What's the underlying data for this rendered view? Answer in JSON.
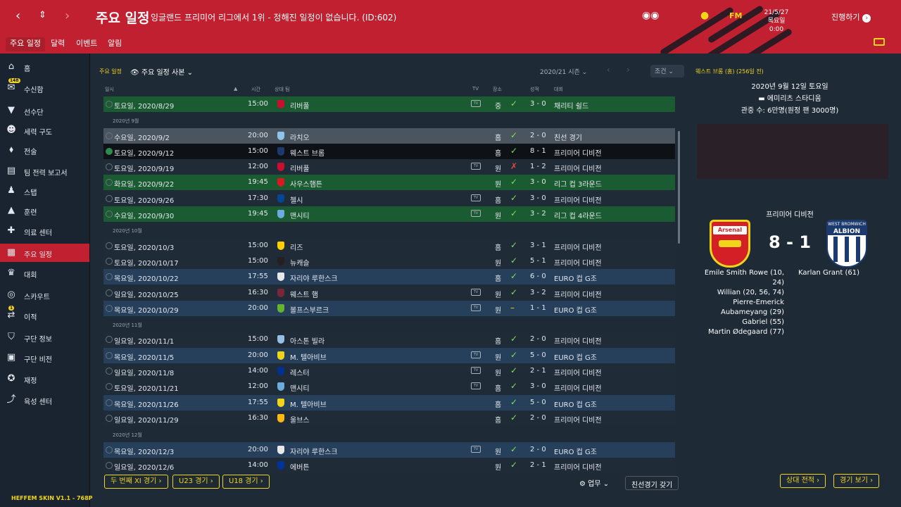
{
  "header": {
    "title": "주요 일정",
    "subtitle": "잉글랜드 프리미어 리그에서 1위 - 정해진 일정이 없습니다. (ID:602)",
    "fm": "FM",
    "date_line1": "21/5/27",
    "date_line2": "목요일 0:00",
    "continue_label": "진행하기"
  },
  "subtabs": [
    "주요 일정",
    "달력",
    "이벤트",
    "알림"
  ],
  "sidebar": {
    "items": [
      {
        "icon": "home-icon",
        "label": "홈"
      },
      {
        "icon": "inbox-icon",
        "label": "수신함",
        "badge": "148"
      },
      {
        "icon": "shirt-icon",
        "label": "선수단"
      },
      {
        "icon": "tactics-icon",
        "label": "세력 구도"
      },
      {
        "icon": "tactics-board-icon",
        "label": "전술"
      },
      {
        "icon": "report-icon",
        "label": "팀 전력 보고서"
      },
      {
        "icon": "staff-icon",
        "label": "스탭"
      },
      {
        "icon": "training-cone-icon",
        "label": "훈련"
      },
      {
        "icon": "medical-icon",
        "label": "의료 센터"
      },
      {
        "icon": "calendar-icon",
        "label": "주요 일정"
      },
      {
        "icon": "trophy-icon",
        "label": "대회"
      },
      {
        "icon": "binoculars-icon",
        "label": "스카우트"
      },
      {
        "icon": "transfer-icon",
        "label": "이적",
        "badge": "1"
      },
      {
        "icon": "shield-icon",
        "label": "구단 정보"
      },
      {
        "icon": "briefcase-icon",
        "label": "구단 비전"
      },
      {
        "icon": "finance-icon",
        "label": "재정"
      },
      {
        "icon": "development-icon",
        "label": "육성 센터"
      }
    ],
    "skin": "HEFFEM SKIN V1.1 - 768P"
  },
  "main": {
    "crumb": "주요 일정",
    "view": "주요 일정 사본",
    "season": "2020/21 시즌",
    "filter": "조건",
    "cols": {
      "date": "일시",
      "time": "시간",
      "opp": "상대 팀",
      "tv": "TV",
      "venue": "장소",
      "result": "성적",
      "comp": "대회"
    }
  },
  "rows": [
    {
      "t": "row",
      "s": "g",
      "date": "토요일, 2020/8/29",
      "time": "15:00",
      "opp": "리버풀",
      "crest": "#c8102e",
      "tv": true,
      "venue": "중",
      "res": "w",
      "score": "3 - 0",
      "comp": "채리티 쉴드"
    },
    {
      "t": "head",
      "label": "2020년 9월"
    },
    {
      "t": "row",
      "s": "sel",
      "date": "수요일, 2020/9/2",
      "time": "20:00",
      "opp": "라치오",
      "crest": "#8fc3e8",
      "tv": false,
      "venue": "홈",
      "res": "w",
      "score": "2 - 0",
      "comp": "친선 경기"
    },
    {
      "t": "row",
      "s": "blk",
      "date": "토요일, 2020/9/12",
      "time": "15:00",
      "opp": "웨스트 브롬",
      "crest": "#1c3a6e",
      "tv": false,
      "venue": "홈",
      "res": "w",
      "score": "8 - 1",
      "comp": "프리미어 디비전",
      "filled": true
    },
    {
      "t": "row",
      "s": "d",
      "date": "토요일, 2020/9/19",
      "time": "12:00",
      "opp": "리버풀",
      "crest": "#c8102e",
      "tv": true,
      "venue": "원",
      "res": "l",
      "score": "1 - 2",
      "comp": "프리미어 디비전"
    },
    {
      "t": "row",
      "s": "g",
      "date": "화요일, 2020/9/22",
      "time": "19:45",
      "opp": "사우스햄튼",
      "crest": "#d71920",
      "tv": false,
      "venue": "원",
      "res": "w",
      "score": "3 - 0",
      "comp": "리그 컵 3라운드"
    },
    {
      "t": "row",
      "s": "d",
      "date": "토요일, 2020/9/26",
      "time": "17:30",
      "opp": "첼시",
      "crest": "#034694",
      "tv": true,
      "venue": "홈",
      "res": "w",
      "score": "3 - 0",
      "comp": "프리미어 디비전"
    },
    {
      "t": "row",
      "s": "g",
      "date": "수요일, 2020/9/30",
      "time": "19:45",
      "opp": "맨시티",
      "crest": "#6cabdd",
      "tv": true,
      "venue": "원",
      "res": "w",
      "score": "3 - 2",
      "comp": "리그 컵 4라운드"
    },
    {
      "t": "head",
      "label": "2020년 10월"
    },
    {
      "t": "row",
      "s": "d",
      "date": "토요일, 2020/10/3",
      "time": "15:00",
      "opp": "리즈",
      "crest": "#ffcd00",
      "tv": false,
      "venue": "홈",
      "res": "w",
      "score": "3 - 1",
      "comp": "프리미어 디비전"
    },
    {
      "t": "row",
      "s": "d",
      "date": "토요일, 2020/10/17",
      "time": "15:00",
      "opp": "뉴캐슬",
      "crest": "#241f20",
      "tv": false,
      "venue": "원",
      "res": "w",
      "score": "5 - 1",
      "comp": "프리미어 디비전"
    },
    {
      "t": "row",
      "s": "b",
      "date": "목요일, 2020/10/22",
      "time": "17:55",
      "opp": "자리야 루한스크",
      "crest": "#e8e8e8",
      "tv": false,
      "venue": "홈",
      "res": "w",
      "score": "6 - 0",
      "comp": "EURO 컵 G조"
    },
    {
      "t": "row",
      "s": "d",
      "date": "일요일, 2020/10/25",
      "time": "16:30",
      "opp": "웨스트 햄",
      "crest": "#7a263a",
      "tv": true,
      "venue": "원",
      "res": "w",
      "score": "3 - 2",
      "comp": "프리미어 디비전"
    },
    {
      "t": "row",
      "s": "b",
      "date": "목요일, 2020/10/29",
      "time": "20:00",
      "opp": "볼프스부르크",
      "crest": "#65b32e",
      "tv": true,
      "venue": "원",
      "res": "d",
      "score": "1 - 1",
      "comp": "EURO 컵 G조"
    },
    {
      "t": "head",
      "label": "2020년 11월"
    },
    {
      "t": "row",
      "s": "d",
      "date": "일요일, 2020/11/1",
      "time": "15:00",
      "opp": "아스톤 빌라",
      "crest": "#95bfe5",
      "tv": false,
      "venue": "홈",
      "res": "w",
      "score": "2 - 0",
      "comp": "프리미어 디비전"
    },
    {
      "t": "row",
      "s": "b",
      "date": "목요일, 2020/11/5",
      "time": "20:00",
      "opp": "M. 텔아비브",
      "crest": "#f1d51a",
      "tv": true,
      "venue": "원",
      "res": "w",
      "score": "5 - 0",
      "comp": "EURO 컵 G조"
    },
    {
      "t": "row",
      "s": "d",
      "date": "일요일, 2020/11/8",
      "time": "14:00",
      "opp": "레스터",
      "crest": "#003090",
      "tv": true,
      "venue": "원",
      "res": "w",
      "score": "2 - 1",
      "comp": "프리미어 디비전"
    },
    {
      "t": "row",
      "s": "d",
      "date": "토요일, 2020/11/21",
      "time": "12:00",
      "opp": "맨시티",
      "crest": "#6cabdd",
      "tv": true,
      "venue": "홈",
      "res": "w",
      "score": "3 - 0",
      "comp": "프리미어 디비전"
    },
    {
      "t": "row",
      "s": "b",
      "date": "목요일, 2020/11/26",
      "time": "17:55",
      "opp": "M. 텔아비브",
      "crest": "#f1d51a",
      "tv": false,
      "venue": "홈",
      "res": "w",
      "score": "5 - 0",
      "comp": "EURO 컵 G조"
    },
    {
      "t": "row",
      "s": "d",
      "date": "일요일, 2020/11/29",
      "time": "16:30",
      "opp": "울브스",
      "crest": "#fdb913",
      "tv": false,
      "venue": "홈",
      "res": "w",
      "score": "2 - 0",
      "comp": "프리미어 디비전"
    },
    {
      "t": "head",
      "label": "2020년 12월"
    },
    {
      "t": "row",
      "s": "b",
      "date": "목요일, 2020/12/3",
      "time": "20:00",
      "opp": "자리야 루한스크",
      "crest": "#e8e8e8",
      "tv": true,
      "venue": "원",
      "res": "w",
      "score": "2 - 0",
      "comp": "EURO 컵 G조"
    },
    {
      "t": "row",
      "s": "d",
      "date": "일요일, 2020/12/6",
      "time": "14:00",
      "opp": "에버튼",
      "crest": "#003399",
      "tv": false,
      "venue": "원",
      "res": "w",
      "score": "2 - 1",
      "comp": "프리미어 디비전"
    }
  ],
  "glyphs": {
    "w": "✓",
    "l": "✗",
    "d": "–",
    "tv": "TV"
  },
  "bottom": {
    "btn1": "두 번째 XI 경기",
    "btn2": "U23 경기",
    "btn3": "U18 경기",
    "duty": "업무",
    "friendly": "친선경기 갖기",
    "h2h": "상대 전적",
    "view_match": "경기 보기"
  },
  "right": {
    "head": "웨스트 브롬 (홈) (256일 전)",
    "date": "2020년 9월 12일 토요일",
    "venue": "에미리츠 스타디움",
    "attendance": "관중 수: 6만명(원정 팬 3000명)",
    "competition": "프리미어 디비전",
    "score": "8 - 1",
    "home_badge": "Arsenal",
    "away_badge_top": "WEST BROMWICH",
    "away_badge_name": "ALBION",
    "home_scorers": [
      "Emile Smith Rowe (10,",
      "24)",
      "Willian (20, 56, 74)",
      "Pierre-Emerick",
      "Aubameyang (29)",
      "Gabriel (55)",
      "Martin Ødegaard (77)"
    ],
    "away_scorers": [
      "Karlan Grant (61)"
    ]
  },
  "colors": {
    "topbar": "#c0202f",
    "accent": "#f1d51a",
    "win": "#7ce05a",
    "loss": "#e64545"
  }
}
